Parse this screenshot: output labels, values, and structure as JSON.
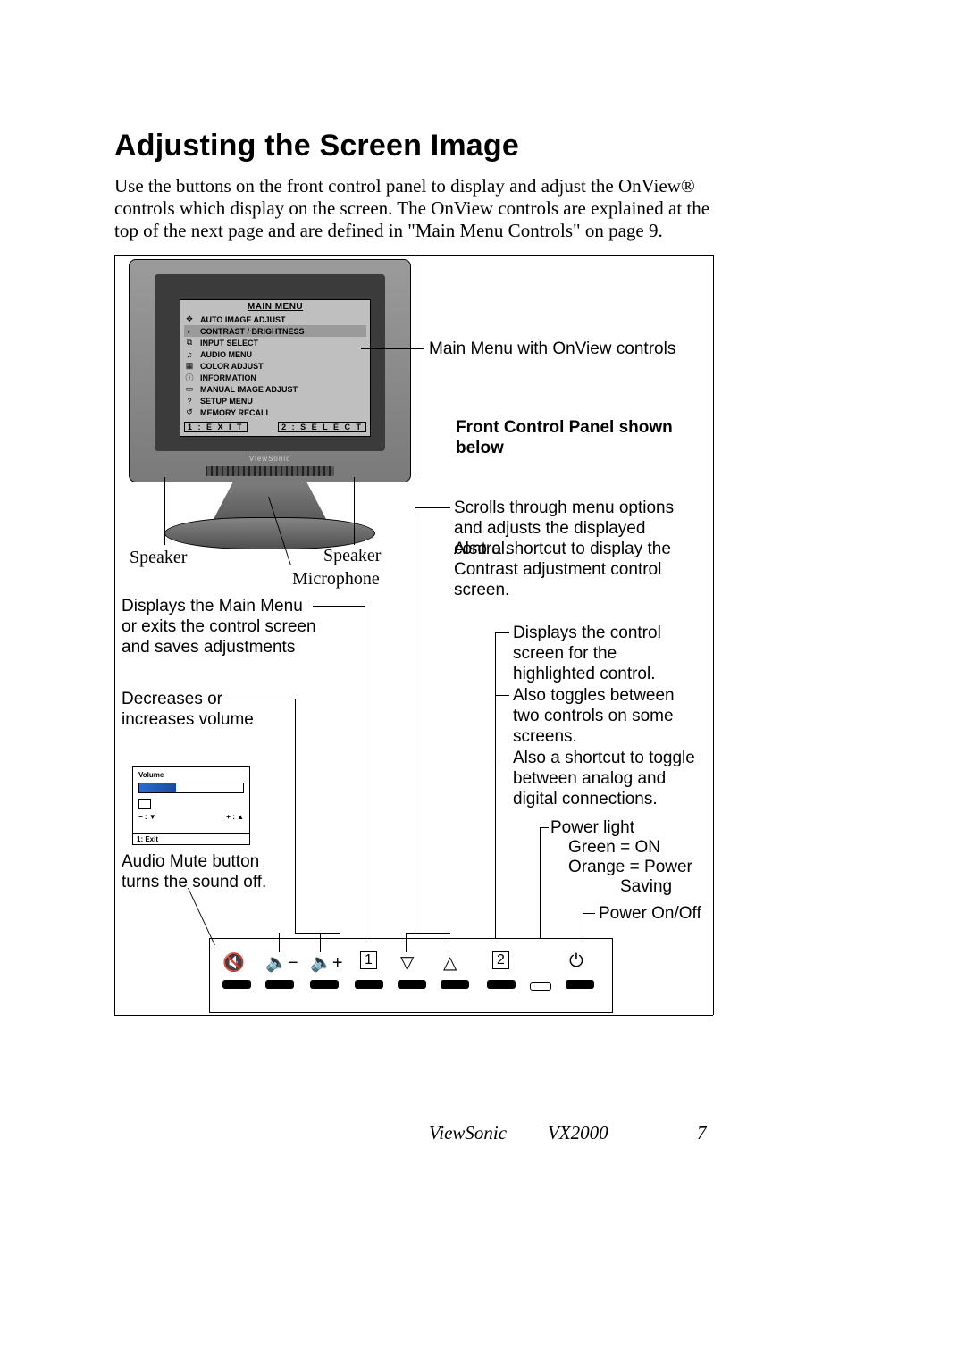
{
  "heading": "Adjusting the Screen Image",
  "intro": "Use the buttons on the front control panel to display and adjust the OnView® controls which display on the screen. The OnView controls are explained at the top of the next page and are defined in \"Main Menu Controls\" on page 9.",
  "monitor_menu": {
    "title": "MAIN MENU",
    "items": [
      "AUTO IMAGE ADJUST",
      "CONTRAST / BRIGHTNESS",
      "INPUT SELECT",
      "AUDIO MENU",
      "COLOR ADJUST",
      "INFORMATION",
      "MANUAL IMAGE ADJUST",
      "SETUP MENU",
      "MEMORY RECALL"
    ],
    "footer_exit": "1 : E X I T",
    "footer_select": "2 : S E L E C T"
  },
  "callouts": {
    "main_menu": "Main Menu with OnView controls",
    "front_panel_heading": "Front Control Panel shown below",
    "speaker": "Speaker",
    "microphone": "Microphone",
    "displays_main_menu": "Displays the Main Menu or exits the control screen and saves adjustments",
    "scrolls": "Scrolls through menu options and adjusts the displayed control.",
    "scrolls_also": "Also a shortcut to display the Contrast adjustment control screen.",
    "displays_control": "Displays the control screen for the highlighted control.",
    "displays_control_also1": "Also toggles between two controls on some screens.",
    "displays_control_also2": "Also a shortcut to toggle between analog and digital connections.",
    "decreases_increases": "Decreases or increases volume",
    "audio_mute": "Audio Mute button turns the sound off.",
    "power_light": "Power light",
    "power_green": "Green = ON",
    "power_orange": "Orange = Power",
    "power_saving": "Saving",
    "power_onoff": "Power On/Off"
  },
  "volume_osd": {
    "title": "Volume",
    "minus": "− : ▼",
    "plus": "+ : ▲",
    "exit": "1: Exit"
  },
  "panel_buttons": {
    "mute": "🔇",
    "vol_down": "🔈−",
    "vol_up": "🔈+",
    "one": "1",
    "down": "▽",
    "up": "△",
    "two": "2",
    "power": "⏻"
  },
  "footer_brand": "ViewSonic",
  "footer_model": "VX2000",
  "page_number": "7"
}
